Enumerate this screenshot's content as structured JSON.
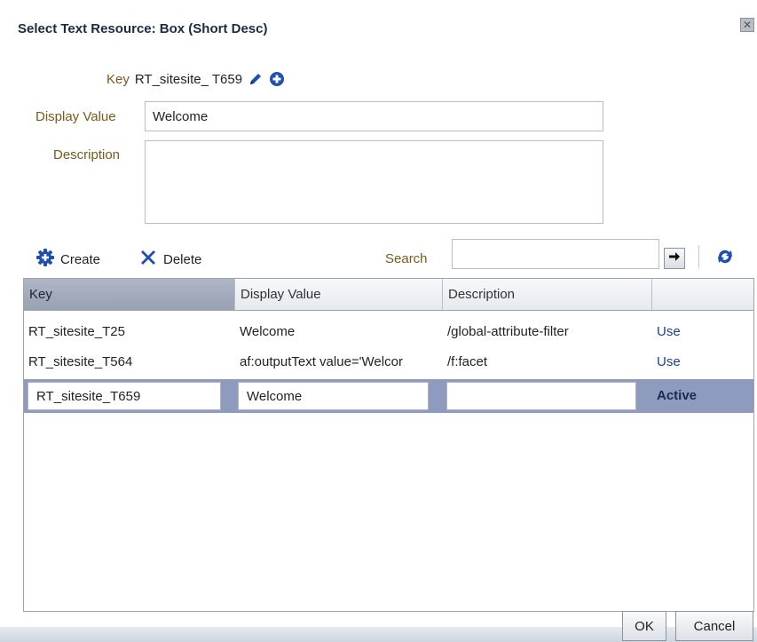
{
  "dialog": {
    "title": "Select Text Resource: Box (Short Desc)",
    "close_label": "✕"
  },
  "form": {
    "key_label": "Key",
    "key_value": "RT_sitesite_ T659",
    "display_value_label": "Display Value",
    "display_value": "Welcome",
    "description_label": "Description",
    "description_value": ""
  },
  "toolbar": {
    "create_label": "Create",
    "delete_label": "Delete",
    "search_label": "Search",
    "search_value": ""
  },
  "table": {
    "columns": [
      "Key",
      "Display Value",
      "Description",
      ""
    ],
    "rows": [
      {
        "key": "RT_sitesite_T25",
        "display_value": "Welcome",
        "description": "/global-attribute-filter",
        "action": "Use"
      },
      {
        "key": "RT_sitesite_T564",
        "display_value": "af:outputText value='Welcor",
        "description": "/f:facet",
        "action": "Use"
      }
    ],
    "edit_row": {
      "key": "RT_sitesite_T659",
      "display_value": "Welcome",
      "description": "",
      "action": "Active"
    }
  },
  "footer": {
    "ok_label": "OK",
    "cancel_label": "Cancel"
  },
  "colors": {
    "accent": "#1f4fb0",
    "link": "#1f3f8f",
    "label": "#7a5a1a",
    "selected_row": "#8e9bbf",
    "sorted_header": "#a3acbc"
  },
  "icons": {
    "key_edit": "pencil-icon",
    "key_add": "add-circle-icon",
    "create": "gear-plus-icon",
    "delete": "x-icon",
    "search_go": "arrow-right-icon",
    "refresh": "refresh-icon",
    "close": "close-icon"
  }
}
